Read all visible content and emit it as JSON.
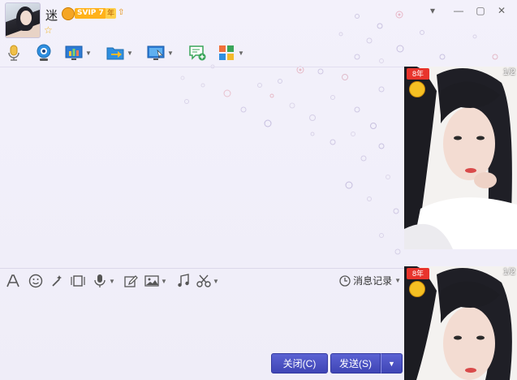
{
  "header": {
    "contact_name": "迷",
    "vip_badge": "SVIP 7",
    "year_badge": "年",
    "window_controls": [
      "chevron-down-icon",
      "minimize-icon",
      "maximize-icon",
      "close-icon"
    ]
  },
  "toolbar": {
    "buttons": [
      {
        "name": "voice-call",
        "icon": "microphone-icon",
        "has_dropdown": false
      },
      {
        "name": "video-call",
        "icon": "webcam-icon",
        "has_dropdown": false
      },
      {
        "name": "remote-desktop",
        "icon": "screen-chart-icon",
        "has_dropdown": true
      },
      {
        "name": "send-file",
        "icon": "folder-arrow-icon",
        "has_dropdown": true
      },
      {
        "name": "screen-share",
        "icon": "monitor-cursor-icon",
        "has_dropdown": true
      },
      {
        "name": "new-chat",
        "icon": "chat-add-icon",
        "has_dropdown": false
      },
      {
        "name": "apps",
        "icon": "apps-grid-icon",
        "has_dropdown": true
      }
    ]
  },
  "input_toolbar": {
    "history_label": "消息记录"
  },
  "buttons": {
    "close_label": "关闭(C)",
    "send_label": "发送(S)"
  },
  "side_photos": {
    "top_counter": "1/2",
    "bottom_counter": "1/2",
    "top_badge": "8年",
    "bottom_badge": "8年"
  },
  "colors": {
    "accent": "#3f45b5",
    "vip": "#ffb21a",
    "background": "#f3f1fb"
  }
}
